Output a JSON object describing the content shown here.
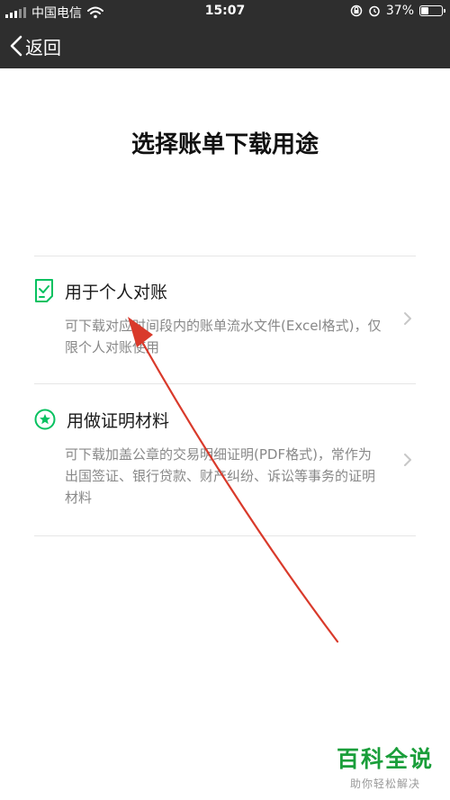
{
  "status_bar": {
    "carrier": "中国电信",
    "time": "15:07",
    "battery": "37%",
    "battery_level": 0.37
  },
  "nav": {
    "back_label": "返回"
  },
  "page": {
    "title": "选择账单下载用途"
  },
  "options": [
    {
      "icon": "checklist-document-icon",
      "title": "用于个人对账",
      "description": "可下载对应时间段内的账单流水文件(Excel格式)，仅限个人对账使用"
    },
    {
      "icon": "star-badge-icon",
      "title": "用做证明材料",
      "description": "可下载加盖公章的交易明细证明(PDF格式)，常作为出国签证、银行贷款、财产纠纷、诉讼等事务的证明材料"
    }
  ],
  "watermark": {
    "main": "百科全说",
    "sub": "助你轻松解决"
  },
  "colors": {
    "accent": "#07c160",
    "bar": "#2e2e2e",
    "annotation_arrow": "#d93a2b"
  }
}
